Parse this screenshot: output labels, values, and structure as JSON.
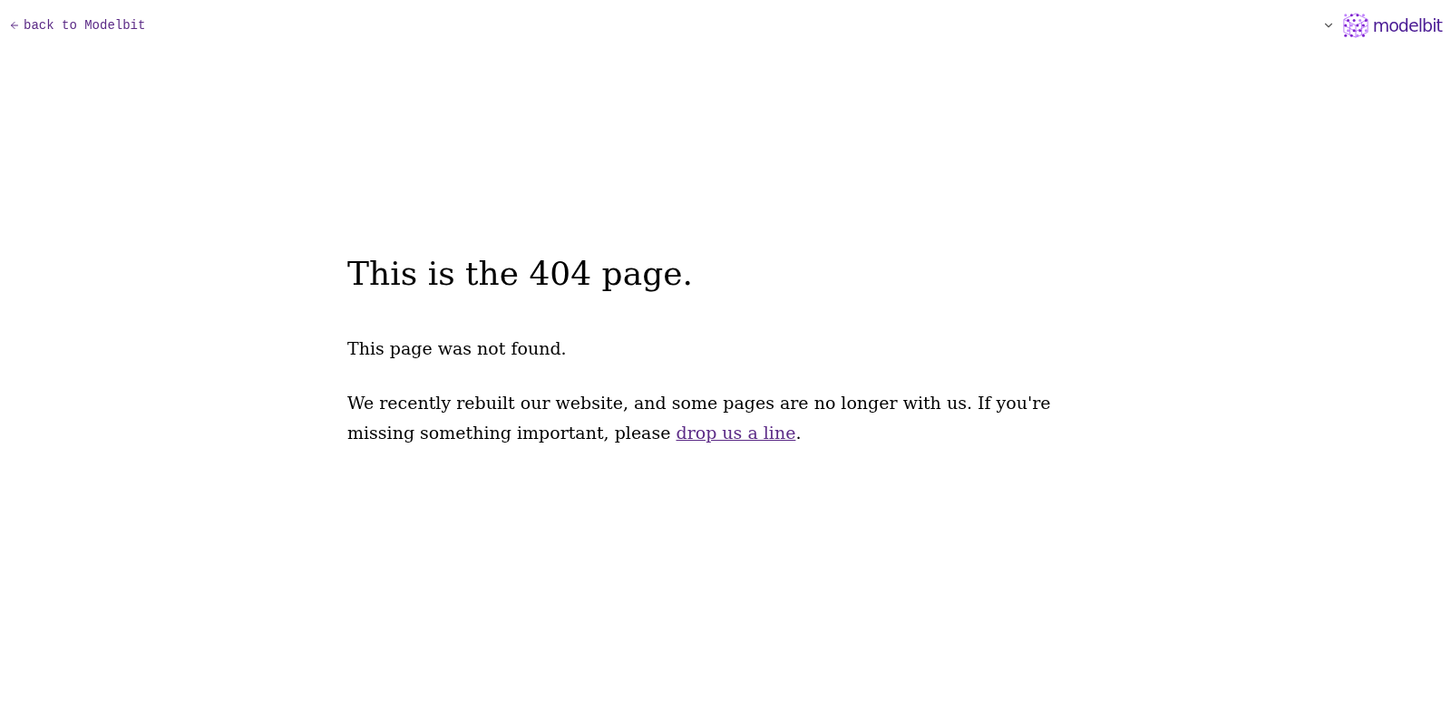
{
  "header": {
    "back_link": "back to Modelbit",
    "logo_text": "modelbit"
  },
  "content": {
    "title": "This is the 404 page.",
    "paragraphs": [
      {
        "text": "This page was not found."
      },
      {
        "text": "We recently rebuilt our website, and some pages are no longer with us. If you're missing something important, please ",
        "link": "drop us a line",
        "after": "."
      }
    ]
  }
}
